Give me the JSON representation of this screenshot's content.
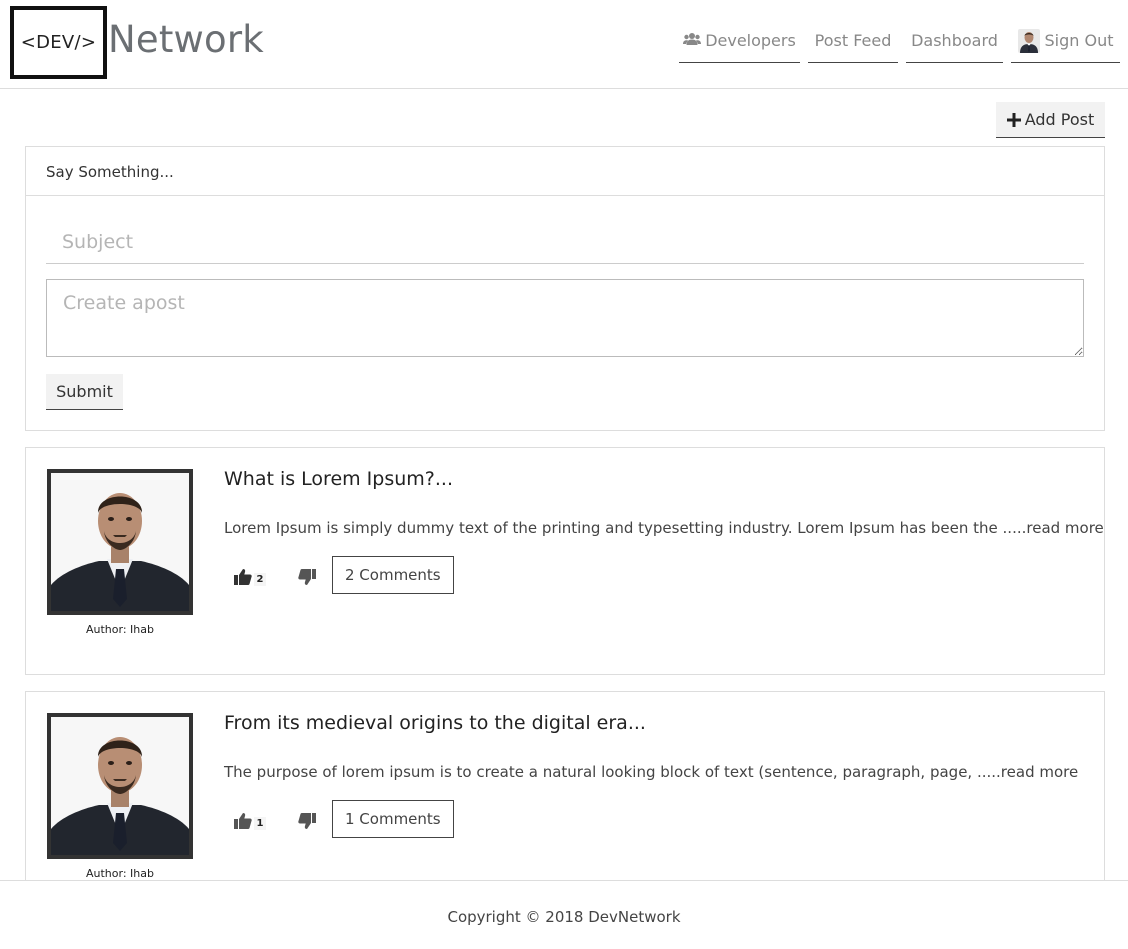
{
  "header": {
    "logo_text": "<DEV/>",
    "brand": "Network",
    "nav": {
      "developers": "Developers",
      "post_feed": "Post Feed",
      "dashboard": "Dashboard",
      "sign_out": "Sign Out"
    }
  },
  "actions": {
    "add_post": "Add Post"
  },
  "compose": {
    "heading": "Say Something...",
    "subject_placeholder": "Subject",
    "body_placeholder": "Create apost",
    "submit": "Submit"
  },
  "posts": [
    {
      "title": "What is Lorem Ipsum?...",
      "body": "Lorem Ipsum is simply dummy text of the printing and typesetting industry. Lorem Ipsum has been the ",
      "read_more": ".....read more",
      "likes": "2",
      "comments": "2 Comments",
      "author": "Author: Ihab"
    },
    {
      "title": "From its medieval origins to the digital era...",
      "body": "The purpose of lorem ipsum is to create a natural looking block of text (sentence, paragraph, page, ",
      "read_more": ".....read more",
      "likes": "1",
      "comments": "1 Comments",
      "author": "Author: Ihab"
    }
  ],
  "footer": {
    "copyright": "Copyright © 2018 DevNetwork"
  },
  "colors": {
    "brand_gray": "#6b6f73",
    "button_bg": "#f2f2f2",
    "border": "#dddddd"
  },
  "icons": {
    "developers": "users-icon",
    "add_post": "plus-icon",
    "like": "thumbs-up-icon",
    "dislike": "thumbs-down-icon"
  }
}
